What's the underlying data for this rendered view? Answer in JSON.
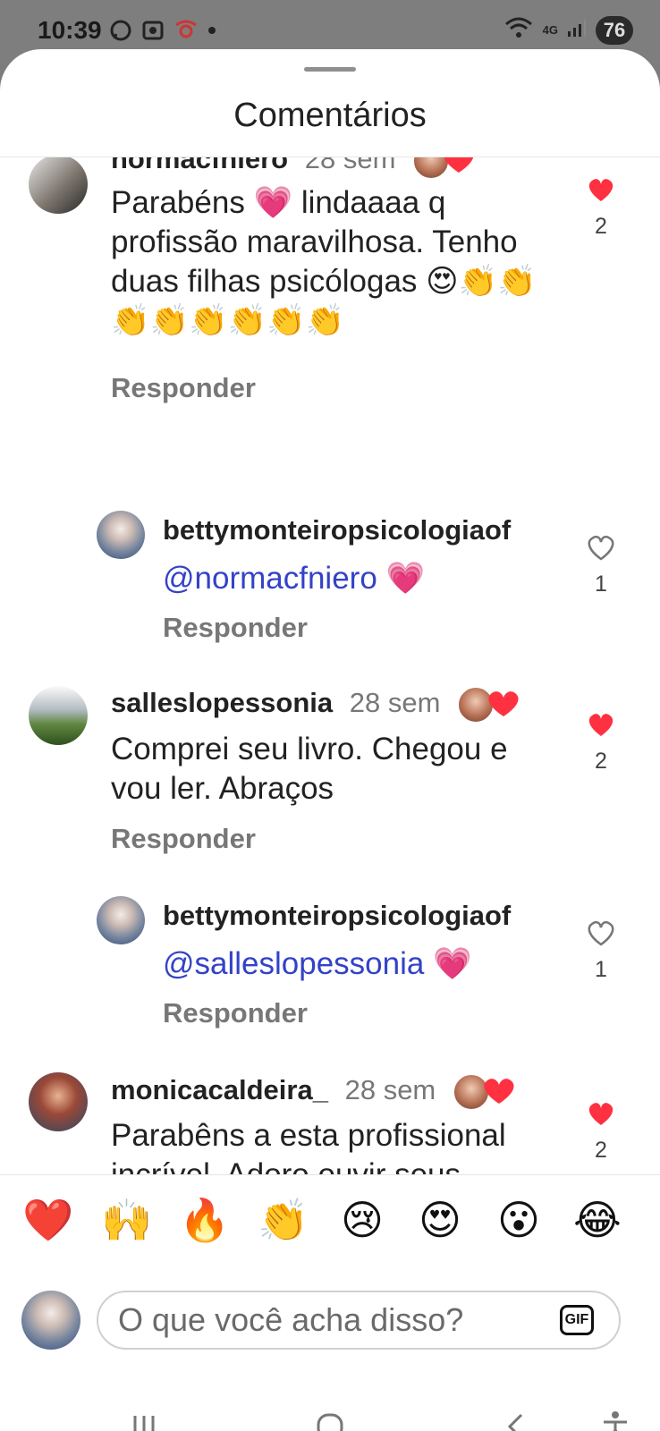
{
  "status_bar": {
    "time": "10:39",
    "network": "4G",
    "battery": "76"
  },
  "sheet": {
    "title": "Comentários"
  },
  "comments": [
    {
      "username": "normacfniero",
      "time": "28 sem",
      "text": "Parabéns 💗 lindaaaa q profissão maravilhosa. Tenho  duas filhas psicólogas 😍👏👏👏👏👏👏👏👏",
      "like_count": "2",
      "respond": "Responder",
      "liked": true
    },
    {
      "username": "bettymonteiropsicologiaof",
      "mention": "@normacfniero",
      "text_tail": " 💗",
      "like_count": "1",
      "respond": "Responder",
      "liked": false
    },
    {
      "username": "salleslopessonia",
      "time": "28 sem",
      "text": "Comprei seu livro. Chegou e vou ler. Abraços",
      "like_count": "2",
      "respond": "Responder",
      "liked": true
    },
    {
      "username": "bettymonteiropsicologiaof",
      "mention": "@salleslopessonia",
      "text_tail": " 💗",
      "like_count": "1",
      "respond": "Responder",
      "liked": false
    },
    {
      "username": "monicacaldeira_",
      "time": "28 sem",
      "text": "Parabêns a esta profissional incrível. Adoro ouvir seus vídeos",
      "like_count": "2",
      "respond": "Responder",
      "liked": true
    }
  ],
  "reactions": [
    "❤️",
    "🙌",
    "🔥",
    "👏",
    "😢",
    "😍",
    "😮",
    "😂"
  ],
  "composer": {
    "placeholder": "O que você acha disso?",
    "gif_label": "GIF"
  },
  "colors": {
    "liked_heart": "#ff3040",
    "mention": "#3442c7",
    "muted_text": "#777777"
  }
}
